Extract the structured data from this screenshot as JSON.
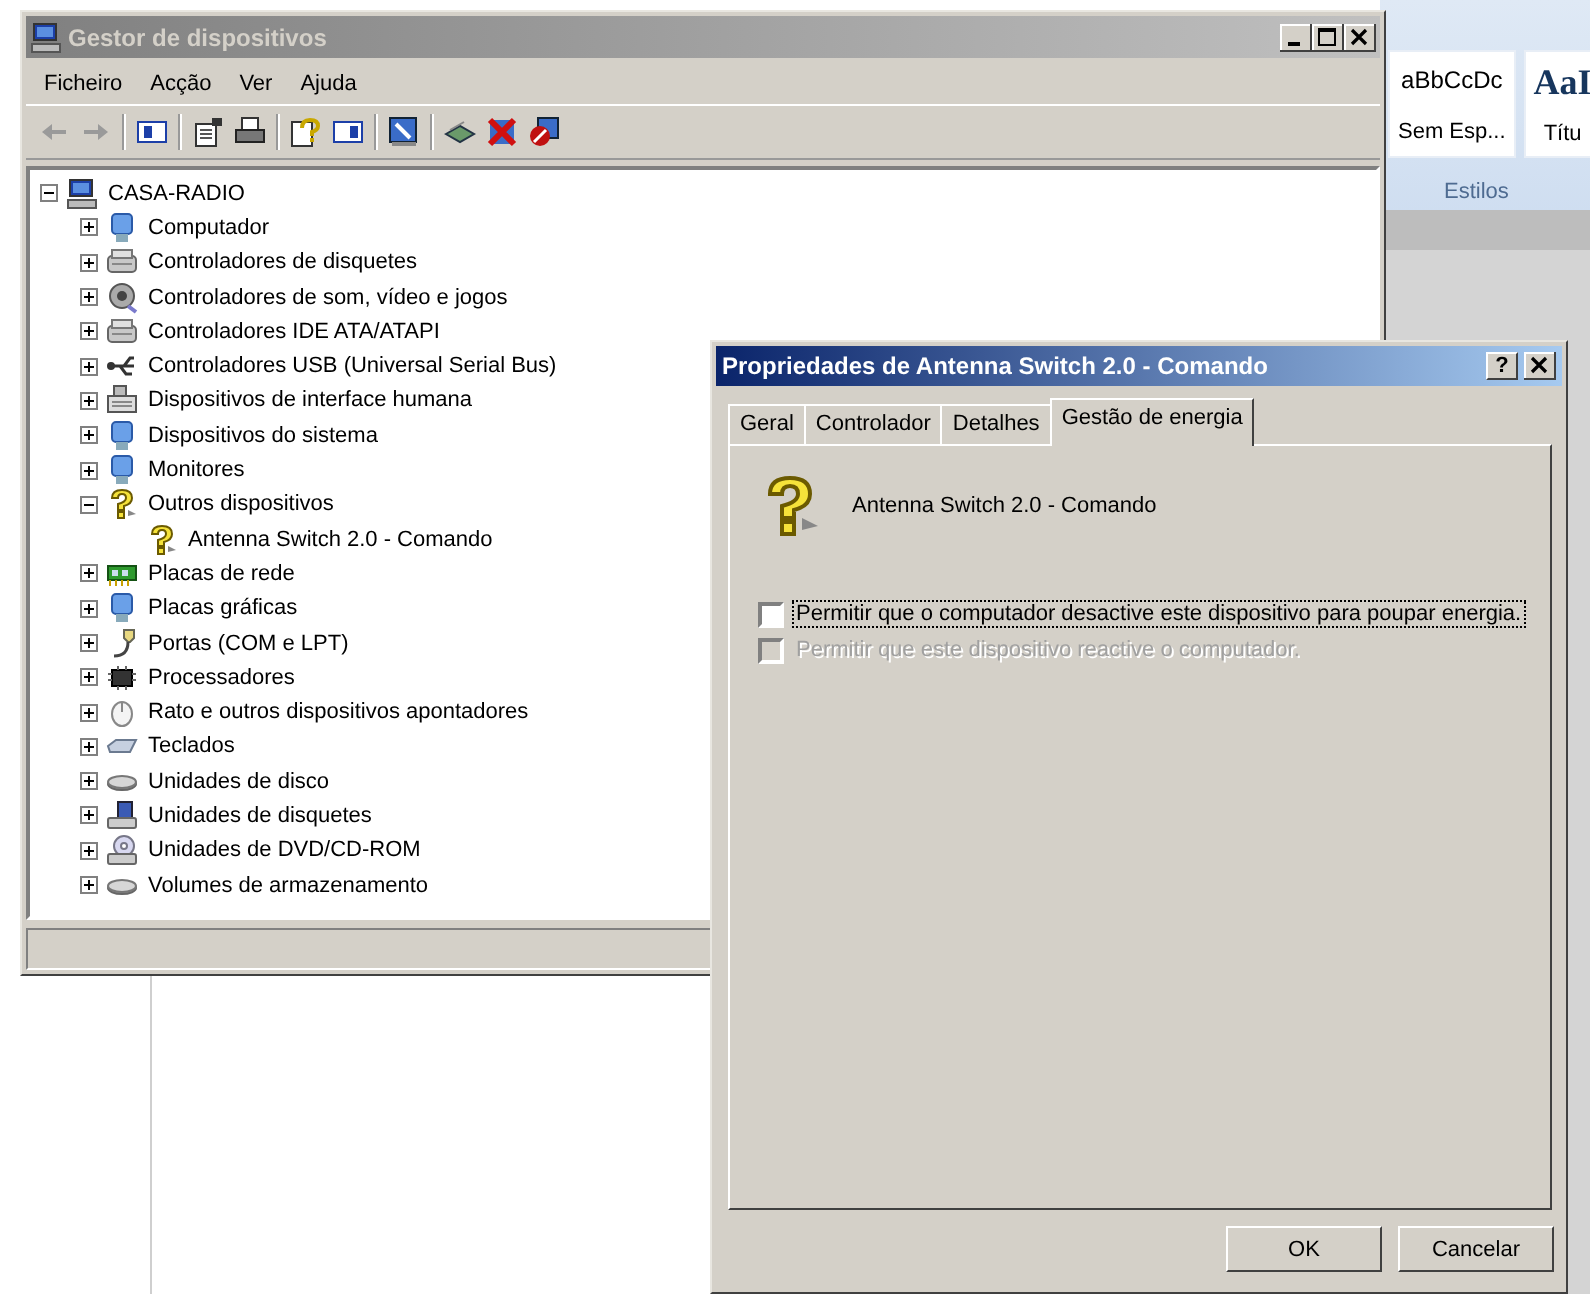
{
  "background_document": {
    "style_gallery": [
      {
        "sample": "aBbCcDc",
        "name": "Sem Esp..."
      },
      {
        "sample": "AaI",
        "name": "Títu"
      }
    ],
    "group_label": "Estilos"
  },
  "device_manager": {
    "title": "Gestor de dispositivos",
    "active": false,
    "menu": [
      "Ficheiro",
      "Acção",
      "Ver",
      "Ajuda"
    ],
    "tree": [
      {
        "label": "CASA-RADIO",
        "expanded": true,
        "children": [
          {
            "label": "Computador",
            "expanded": false
          },
          {
            "label": "Controladores de disquetes",
            "expanded": false
          },
          {
            "label": "Controladores de som, vídeo e jogos",
            "expanded": false
          },
          {
            "label": "Controladores IDE ATA/ATAPI",
            "expanded": false
          },
          {
            "label": "Controladores USB (Universal Serial Bus)",
            "expanded": false
          },
          {
            "label": "Dispositivos de interface humana",
            "expanded": false
          },
          {
            "label": "Dispositivos do sistema",
            "expanded": false
          },
          {
            "label": "Monitores",
            "expanded": false
          },
          {
            "label": "Outros dispositivos",
            "expanded": true,
            "children": [
              {
                "label": "Antenna Switch 2.0 - Comando"
              }
            ]
          },
          {
            "label": "Placas de rede",
            "expanded": false
          },
          {
            "label": "Placas gráficas",
            "expanded": false
          },
          {
            "label": "Portas (COM e LPT)",
            "expanded": false
          },
          {
            "label": "Processadores",
            "expanded": false
          },
          {
            "label": "Rato e outros dispositivos apontadores",
            "expanded": false
          },
          {
            "label": "Teclados",
            "expanded": false
          },
          {
            "label": "Unidades de disco",
            "expanded": false
          },
          {
            "label": "Unidades de disquetes",
            "expanded": false
          },
          {
            "label": "Unidades de DVD/CD-ROM",
            "expanded": false
          },
          {
            "label": "Volumes de armazenamento",
            "expanded": false
          }
        ]
      }
    ]
  },
  "properties_dialog": {
    "title": "Propriedades de Antenna Switch 2.0 - Comando",
    "active": true,
    "help_button": "?",
    "tabs": [
      {
        "label": "Geral",
        "selected": false
      },
      {
        "label": "Controlador",
        "selected": false
      },
      {
        "label": "Detalhes",
        "selected": false
      },
      {
        "label": "Gestão de energia",
        "selected": true
      }
    ],
    "device_name": "Antenna Switch 2.0 - Comando",
    "options": [
      {
        "label": "Permitir que o computador desactive este dispositivo para poupar energia.",
        "checked": false,
        "disabled": false,
        "focused": true
      },
      {
        "label": "Permitir que este dispositivo reactive o computador.",
        "checked": false,
        "disabled": true,
        "focused": false
      }
    ],
    "buttons": [
      "OK",
      "Cancelar"
    ]
  }
}
